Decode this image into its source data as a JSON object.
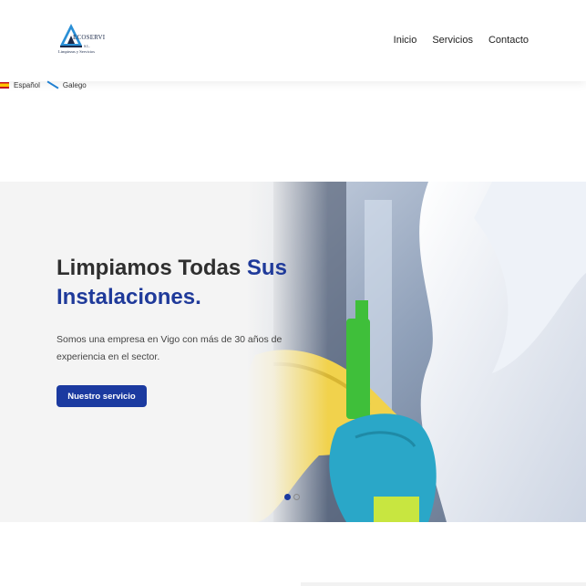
{
  "brand": {
    "logo_name": "ECOSERVI",
    "logo_suffix": "S.L.",
    "logo_tagline": "Limpiezas y Servicios"
  },
  "nav": {
    "items": [
      "Inicio",
      "Servicios",
      "Contacto"
    ]
  },
  "languages": {
    "spanish": "Español",
    "galician": "Galego"
  },
  "hero": {
    "title_part1": "Limpiamos Todas ",
    "title_accent1": "Sus",
    "title_accent2": "Instalaciones.",
    "description": "Somos una empresa en Vigo con más de 30 años de experiencia en el sector.",
    "button_label": "Nuestro servicio",
    "slider": {
      "slides": 2,
      "active_index": 0
    }
  },
  "colors": {
    "accent": "#1b3aa0",
    "glove": "#2aa7c8",
    "cloth": "#f1d24c"
  }
}
